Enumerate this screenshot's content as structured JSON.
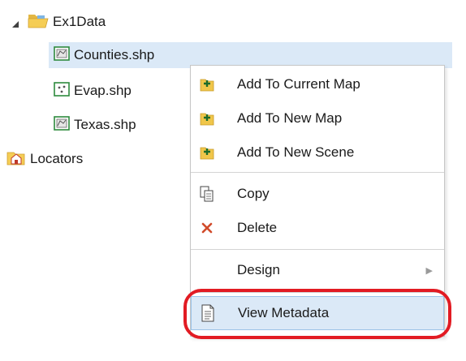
{
  "tree": {
    "root": {
      "label": "Ex1Data",
      "icon": "folder-open-icon"
    },
    "items": [
      {
        "label": "Counties.shp",
        "icon": "polygon-shapefile-icon",
        "selected": true
      },
      {
        "label": "Evap.shp",
        "icon": "point-shapefile-icon",
        "selected": false
      },
      {
        "label": "Texas.shp",
        "icon": "polygon-shapefile-icon",
        "selected": false
      }
    ],
    "locators": {
      "label": "Locators",
      "icon": "locators-icon"
    }
  },
  "context_menu": {
    "items": [
      {
        "label": "Add To Current Map",
        "icon": "add-data-icon"
      },
      {
        "label": "Add To New Map",
        "icon": "add-data-icon"
      },
      {
        "label": "Add To New Scene",
        "icon": "add-data-icon"
      },
      {
        "label": "Copy",
        "icon": "copy-icon"
      },
      {
        "label": "Delete",
        "icon": "delete-x-icon"
      },
      {
        "label": "Design",
        "icon": "",
        "submenu": true
      },
      {
        "label": "View Metadata",
        "icon": "metadata-icon",
        "hovered": true
      }
    ]
  },
  "colors": {
    "selection": "#dbe9f7",
    "highlight_ring": "#e21b23",
    "delete_icon": "#d14b2b"
  }
}
